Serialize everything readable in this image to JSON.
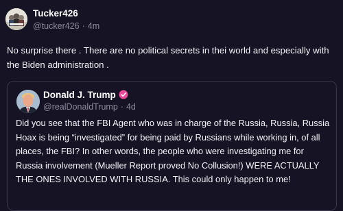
{
  "post": {
    "author_name": "Tucker426",
    "author_handle": "@tucker426",
    "separator": "·",
    "time": "4m",
    "text": "No surprise there . There are no political secrets in thei world and especially with the Biden administration ."
  },
  "quoted_post": {
    "author_name": "Donald J. Trump",
    "author_handle": "@realDonaldTrump",
    "separator": "·",
    "time": "4d",
    "verified_icon": "verified-badge-icon",
    "text": "Did you see that the FBI Agent who was in charge of the Russia, Russia, Russia Hoax is being “investigated” for being paid by Russians while working in, of all places, the FBI? In other words, the people who were investigating me for Russia involvement (Mueller Report proved No Collusion!) WERE ACTUALLY THE ONES INVOLVED WITH RUSSIA. This could only happen to me!"
  },
  "colors": {
    "background": "#161424",
    "border": "#3a374a",
    "muted_text": "#8d8a9c",
    "verified_badge": "#ec4899"
  }
}
